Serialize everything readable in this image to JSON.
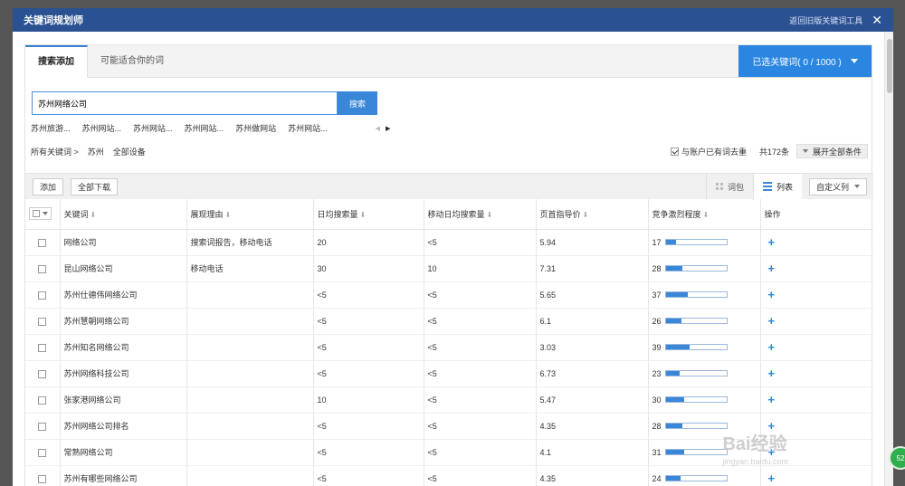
{
  "window": {
    "title": "关键词规划师",
    "back_link": "返回旧版关键词工具",
    "close": "✕"
  },
  "tabs": [
    {
      "label": "搜索添加"
    },
    {
      "label": "可能适合你的词"
    }
  ],
  "selected_keywords": {
    "label": "已选关键词( 0 / 1000 )"
  },
  "search": {
    "value": "苏州网络公司",
    "button": "搜索"
  },
  "suggestions": [
    "苏州旅游...",
    "苏州网站...",
    "苏州网站...",
    "苏州网站...",
    "苏州做网站",
    "苏州网站..."
  ],
  "filters": {
    "breadcrumb": [
      "所有关键词 >",
      "苏州",
      "全部设备"
    ],
    "dedup_label": "与账户已有词去重",
    "count": "共172条",
    "expand_label": "展开全部条件"
  },
  "toolbar": {
    "add": "添加",
    "download_all": "全部下载",
    "view_bundle": "词包",
    "view_list": "列表",
    "custom_columns": "自定义列"
  },
  "table": {
    "headers": [
      "关键词",
      "展现理由",
      "日均搜索量",
      "移动日均搜索量",
      "页首指导价",
      "竞争激烈程度",
      "操作"
    ],
    "rows": [
      {
        "keyword": "网络公司",
        "reason": "搜索词报告，移动电话",
        "daily": "20",
        "mobile": "<5",
        "price": "5.94",
        "competition": 17
      },
      {
        "keyword": "昆山网络公司",
        "reason": "移动电话",
        "daily": "30",
        "mobile": "10",
        "price": "7.31",
        "competition": 28
      },
      {
        "keyword": "苏州仕德伟网络公司",
        "reason": "",
        "daily": "<5",
        "mobile": "<5",
        "price": "5.65",
        "competition": 37
      },
      {
        "keyword": "苏州慧朝网络公司",
        "reason": "",
        "daily": "<5",
        "mobile": "<5",
        "price": "6.1",
        "competition": 26
      },
      {
        "keyword": "苏州知名网络公司",
        "reason": "",
        "daily": "<5",
        "mobile": "<5",
        "price": "3.03",
        "competition": 39
      },
      {
        "keyword": "苏州网络科技公司",
        "reason": "",
        "daily": "<5",
        "mobile": "<5",
        "price": "6.73",
        "competition": 23
      },
      {
        "keyword": "张家港网络公司",
        "reason": "",
        "daily": "10",
        "mobile": "<5",
        "price": "5.47",
        "competition": 30
      },
      {
        "keyword": "苏州网络公司排名",
        "reason": "",
        "daily": "<5",
        "mobile": "<5",
        "price": "4.35",
        "competition": 28
      },
      {
        "keyword": "常熟网络公司",
        "reason": "",
        "daily": "<5",
        "mobile": "<5",
        "price": "4.1",
        "competition": 31
      },
      {
        "keyword": "苏州有哪些网络公司",
        "reason": "",
        "daily": "<5",
        "mobile": "<5",
        "price": "4.35",
        "competition": 24
      }
    ],
    "action": "+"
  },
  "watermark": {
    "brand": "Bai经验",
    "url": "jingyan.baidu.com"
  },
  "colors": {
    "titlebar": "#2a5192",
    "accent": "#2a86e0",
    "bar_fill": "#3a86d8"
  }
}
